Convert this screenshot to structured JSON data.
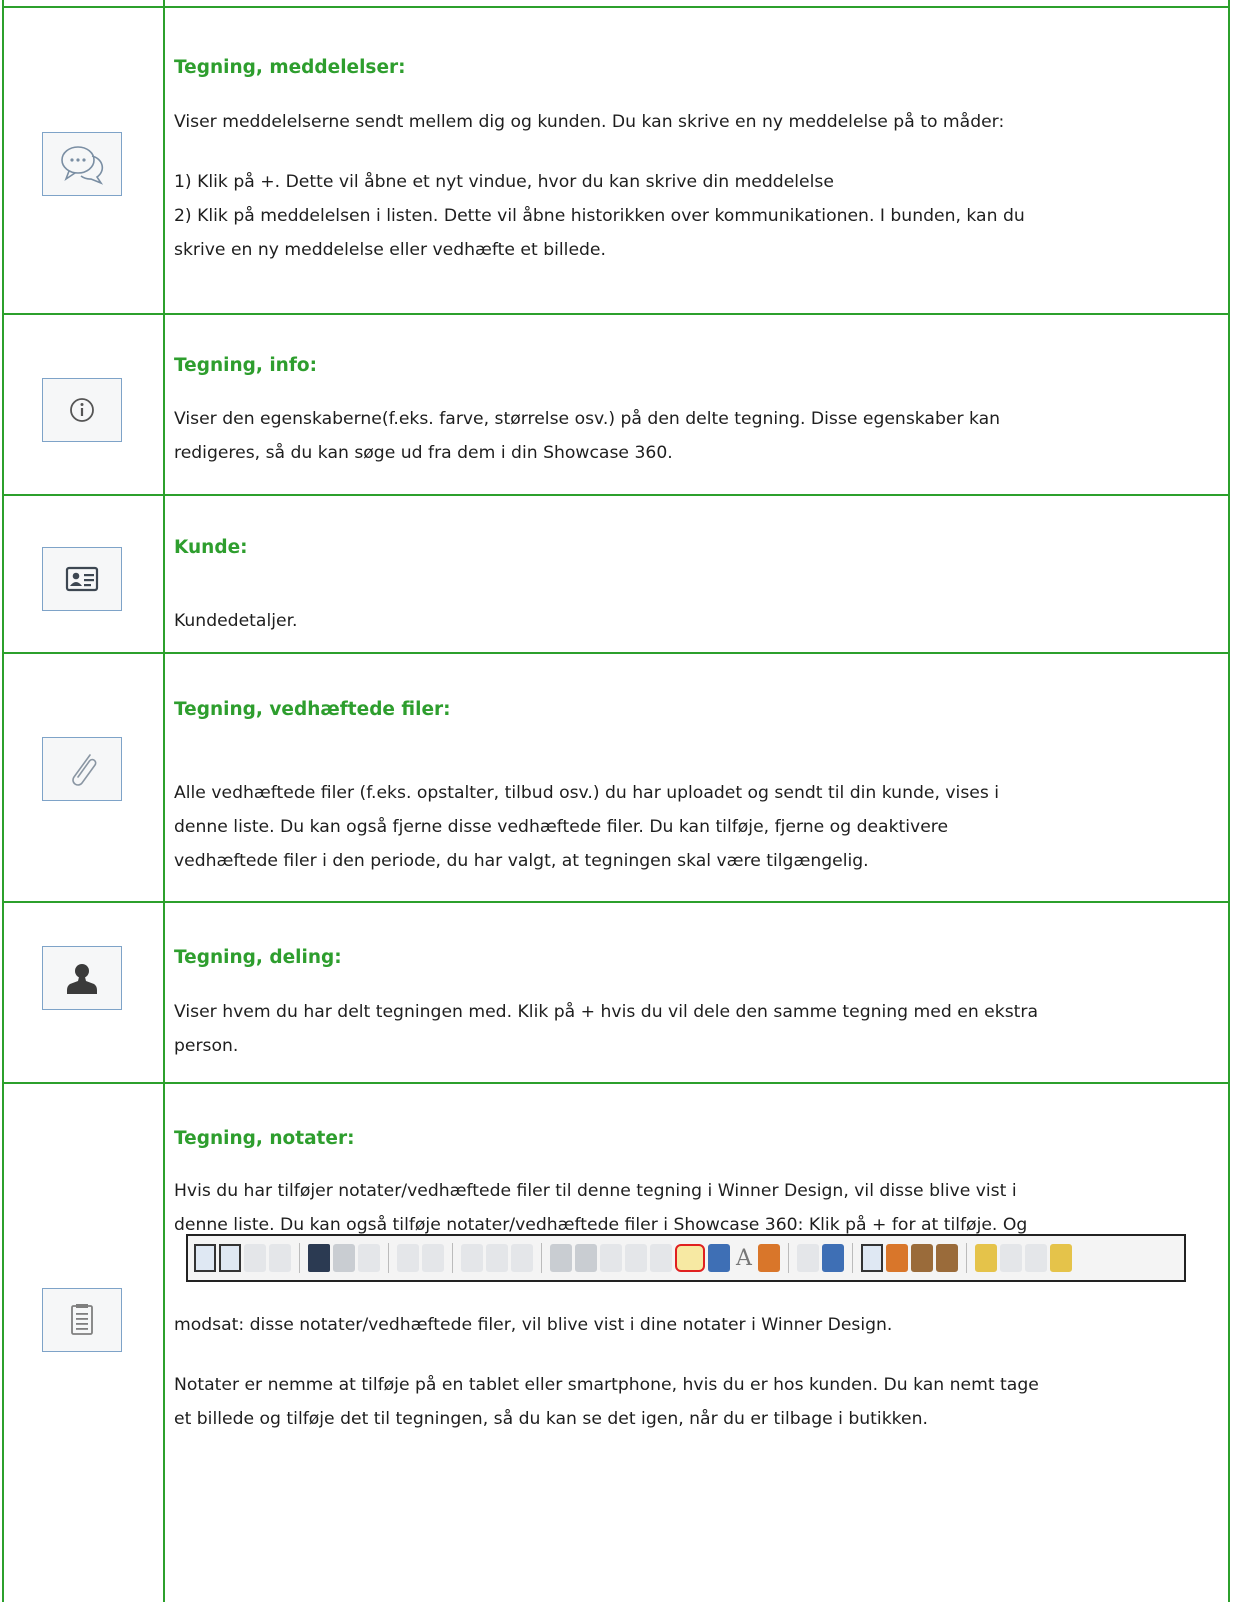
{
  "sections": [
    {
      "icon": "chat-bubbles-icon",
      "heading": "Tegning, meddelelser:",
      "lines": [
        "Viser meddelelserne sendt mellem dig og kunden. Du kan skrive en ny meddelelse på to måder:",
        "1) Klik på +. Dette vil åbne et nyt vindue, hvor du kan skrive din meddelelse",
        "2) Klik på meddelelsen i listen. Dette vil åbne historikken over kommunikationen. I bunden, kan du",
        "skrive en ny meddelelse eller vedhæfte et billede."
      ]
    },
    {
      "icon": "info-icon",
      "heading": "Tegning, info:",
      "lines": [
        "Viser den egenskaberne(f.eks. farve, størrelse osv.) på den delte tegning. Disse egenskaber kan",
        "redigeres, så du kan søge ud fra dem i din Showcase 360."
      ]
    },
    {
      "icon": "contact-card-icon",
      "heading": "Kunde:",
      "lines": [
        "Kundedetaljer."
      ]
    },
    {
      "icon": "paperclip-icon",
      "heading": "Tegning, vedhæftede filer:",
      "lines": [
        "Alle vedhæftede filer (f.eks. opstalter, tilbud osv.) du har uploadet og sendt til din kunde, vises i",
        "denne liste. Du kan også fjerne disse vedhæftede filer. Du kan tilføje, fjerne og deaktivere",
        "vedhæftede filer i den periode, du har valgt, at tegningen skal være tilgængelig."
      ]
    },
    {
      "icon": "person-icon",
      "heading": "Tegning, deling:",
      "lines": [
        "Viser hvem du har delt tegningen med. Klik på + hvis du vil dele den samme tegning med en ekstra",
        "person."
      ]
    },
    {
      "icon": "notepad-icon",
      "heading": "Tegning, notater:",
      "lines": [
        "Hvis du har tilføjer notater/vedhæftede filer til denne tegning i Winner Design, vil disse blive vist i",
        "denne liste. Du kan også tilføje notater/vedhæftede filer i Showcase 360: Klik på + for at tilføje. Og"
      ],
      "after_toolbar": "modsat: disse notater/vedhæftede filer, vil blive vist i dine notater i Winner Design.",
      "closing_lines": [
        "Notater er nemme at tilføje på en tablet eller smartphone, hvis du er hos kunden. Du kan nemt tage",
        "et billede og tilføje det til tegningen, så du kan se det igen, når du er tilbage i butikken."
      ]
    }
  ],
  "toolbar": {
    "text_tool_glyph": "A",
    "highlighted_button": "notes-button"
  }
}
